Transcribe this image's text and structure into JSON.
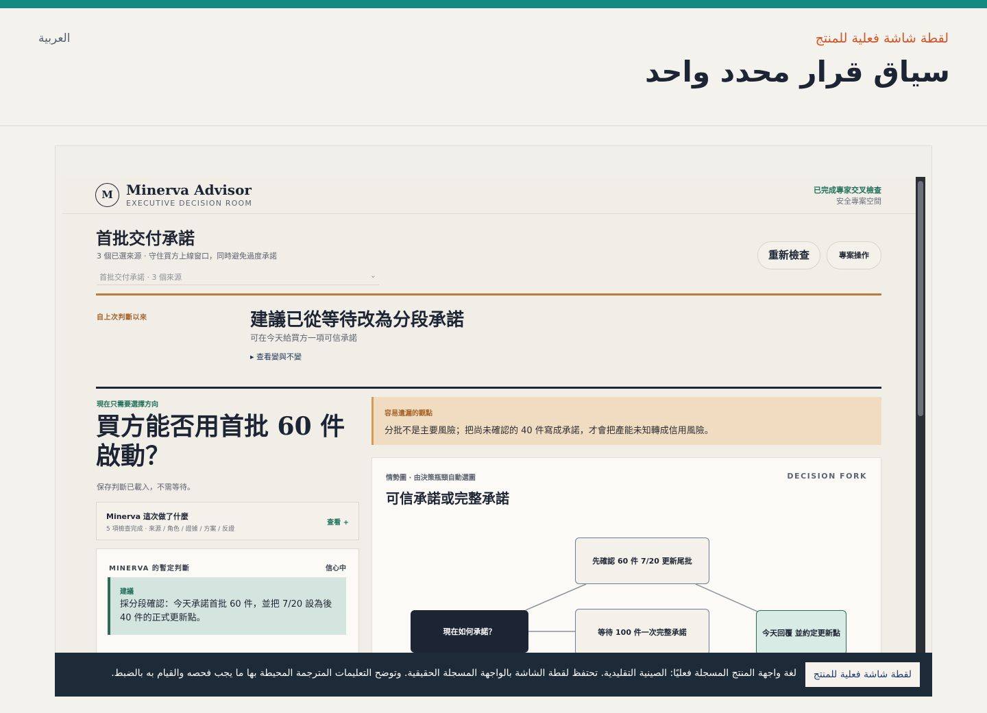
{
  "page": {
    "language_link": "العربية",
    "kicker": "لقطة شاشة فعلية للمنتج",
    "title": "سياق قرار محدد واحد"
  },
  "app": {
    "brand": {
      "mark": "M",
      "name": "Minerva Advisor",
      "subtitle": "EXECUTIVE DECISION ROOM"
    },
    "status": {
      "verified": "已完成專家交叉檢查",
      "workspace": "安全專案空間"
    },
    "section": {
      "title": "首批交付承諾",
      "subtitle": "3 個已選來源 · 守住買方上線窗口，同時避免過度承諾",
      "select_value": "首批交付承諾 · 3 個來源",
      "select_chevron": "⌄"
    },
    "actions": {
      "recheck": "重新檢查",
      "project_ops": "專案操作"
    },
    "since_last": {
      "label": "自上次判斷以來",
      "title": "建議已從等待改為分段承諾",
      "subtitle": "可在今天給買方一項可信承諾",
      "link": "▸ 查看變與不變"
    },
    "question": {
      "label": "現在只需要選擇方向",
      "text": "買方能否用首批 60 件啟動？",
      "saved_note": "保存判斷已載入，不需等待。"
    },
    "did_card": {
      "title": "Minerva 這次做了什麼",
      "subtitle": "5 項檢查完成 · 來源 / 角色 / 證據 / 方案 / 反證",
      "view": "查看 +"
    },
    "judgment": {
      "title": "MINERVA 的暫定判斷",
      "confidence": "信心中",
      "label": "建議",
      "text": "採分段確認：今天承諾首批 60 件，並把 7/20 設為後 40 件的正式更新點。"
    },
    "note": {
      "label": "容易遺漏的觀點",
      "text": "分批不是主要風險；把尚未確認的 40 件寫成承諾，才會把產能未知轉成信用風險。"
    },
    "diagram": {
      "label": "情勢圖 · 由決策瓶頸自動選圖",
      "tag": "DECISION FORK",
      "title": "可信承諾或完整承諾",
      "nodes": {
        "root": "現在如何承諾？",
        "top": "先確認 60 件 7/20 更新尾批",
        "mid": "等待 100 件一次完整承諾",
        "right": "今天回覆 並約定更新點"
      }
    }
  },
  "banner": {
    "badge": "لقطة شاشة فعلية للمنتج",
    "text": "لغة واجهة المنتج المسجلة فعليًا: الصينية التقليدية. تحتفظ لقطة الشاشة بالواجهة المسجلة الحقيقية. وتوضح التعليمات المترجمة المحيطة بها ما يجب فحصه والقيام به بالضبط."
  },
  "colors": {
    "topbar": "#138a80",
    "kicker": "#d2552a",
    "copper": "#b87a3d",
    "teal": "#1f6f5a",
    "ink": "#1d2433",
    "note_bg": "#f0dcc0",
    "judgment_bg": "#d4e4de",
    "banner_bg": "#1d2a38"
  }
}
